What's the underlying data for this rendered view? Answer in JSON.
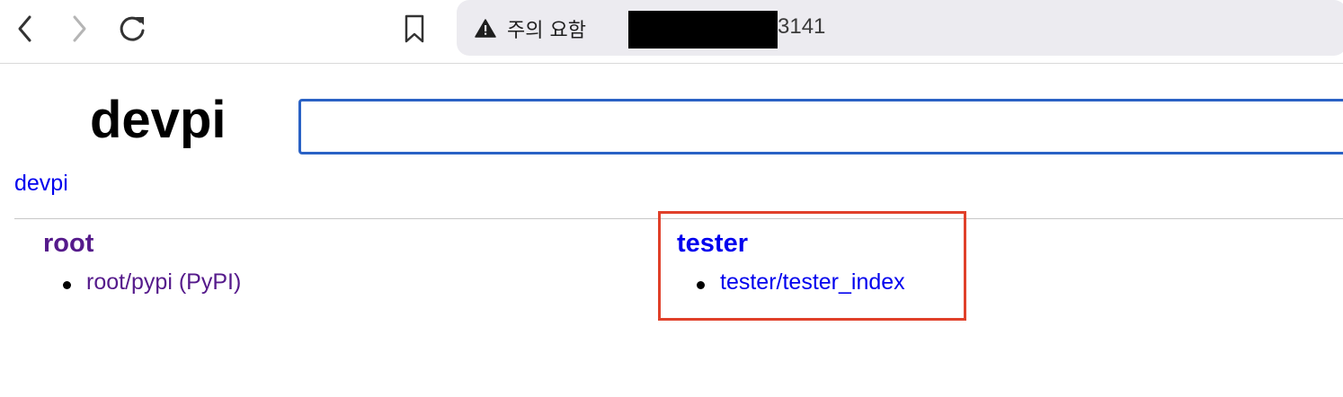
{
  "browser": {
    "security_warning": "주의 요함",
    "url_visible_suffix": "3141"
  },
  "page": {
    "brand_title": "devpi",
    "breadcrumb": "devpi",
    "search_value": ""
  },
  "users": [
    {
      "name": "root",
      "indexes": [
        {
          "label": "root/pypi (PyPI)"
        }
      ]
    },
    {
      "name": "tester",
      "indexes": [
        {
          "label": "tester/tester_index"
        }
      ]
    }
  ],
  "colors": {
    "visited_link": "#551a8b",
    "link": "#0000ee",
    "search_border": "#2a62c5",
    "highlight_box": "#e0402a"
  }
}
